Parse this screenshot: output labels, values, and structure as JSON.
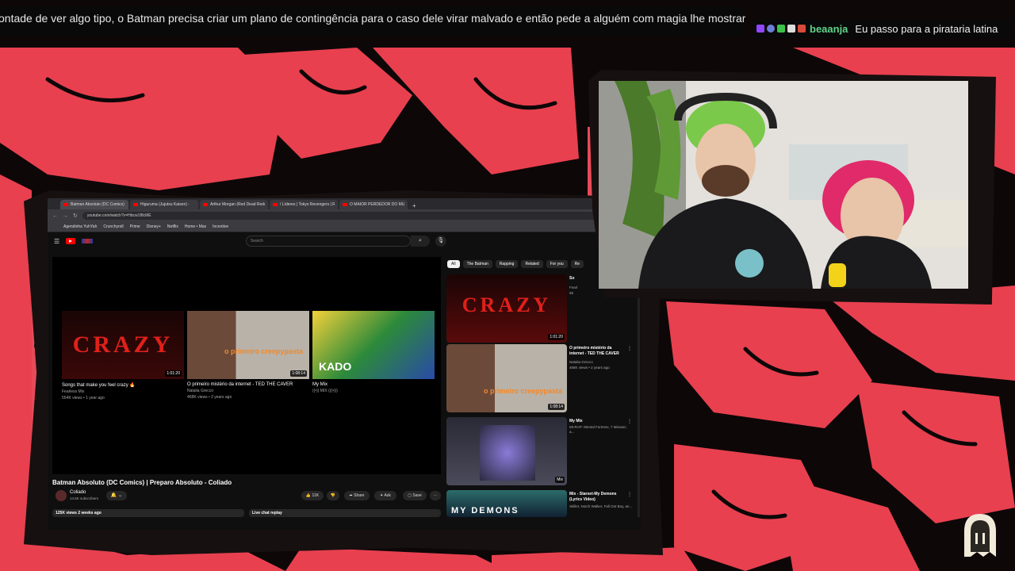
{
  "ticker": {
    "text": "ontade de ver algo tipo, o Batman precisa criar um plano de contingência para o caso dele virar malvado e então pede a alguém com magia lhe mostrar esses"
  },
  "chat": {
    "username": "beaanja",
    "message": "Eu passo para a pirataria latina",
    "badges": [
      "twitch-badge",
      "globe-badge",
      "check-badge",
      "pixel-badge",
      "mask-badge"
    ]
  },
  "colors": {
    "background_red": "#e8404f",
    "background_dark": "#0e0708",
    "accent_green": "#5fd38a"
  },
  "browser": {
    "tabs": [
      {
        "label": "Batman Absoluto (DC Comics) |"
      },
      {
        "label": "Higuruma (Jujutsu Kaisen) -"
      },
      {
        "label": "Arthur Morgan (Red Dead Rede"
      },
      {
        "label": "/ Líderes | Tokyo Revengers | R"
      },
      {
        "label": "O MAIOR PERDEDOR DO MUN"
      }
    ],
    "new_tab": "+",
    "url": "youtube.com/watch?v=Hbcw1f8cME",
    "bookmarks": [
      "Agendinha YuhYah",
      "Crunchyroll",
      "Prime",
      "Disney+",
      "Netflix",
      "Home • Max",
      "Incentive"
    ]
  },
  "youtube": {
    "search_placeholder": "Search",
    "search_icon": "search-icon",
    "endcards": [
      {
        "title": "Songs that make you feel crazy 🔥",
        "channel": "Fearless Mix",
        "meta": "554K views • 1 year ago",
        "duration": "1:01:20",
        "thumb_text": "CRAZY"
      },
      {
        "title": "O primeiro mistério da internet - TED THE CAVER",
        "channel": "Natalia Grecco",
        "meta": "468K views • 2 years ago",
        "duration": "1:08:14",
        "thumb_text": "o primeiro creepypasta"
      },
      {
        "title": "My Mix",
        "channel": "",
        "meta": "((•)) MIX (((•)))",
        "duration": "",
        "thumb_text": "KADO"
      }
    ],
    "video_title": "Batman Absoluto (DC Comics) | Preparo Absoluto - Coliado",
    "channel_name": "Coliado",
    "subscribers": "14.6K subscribers",
    "likes": "11K",
    "share_label": "Share",
    "ask_label": "Ask",
    "save_label": "Save",
    "views_line": "125K views  2 weeks ago",
    "live_chat": "Live chat replay",
    "chips": [
      "All",
      "The Batman",
      "Rapping",
      "Related",
      "For you",
      "Re"
    ],
    "recommendations": [
      {
        "title": "So",
        "meta": "Fearl",
        "meta2": "55",
        "duration": "1:01:20",
        "thumb_text": "CRAZY"
      },
      {
        "title": "O primeiro mistério da internet - TED THE CAVER",
        "meta": "Natalia Grecco",
        "meta2": "468K views • 2 years ago",
        "duration": "1:08:14",
        "thumb_text": "o primeiro creepypasta"
      },
      {
        "title": "My Mix",
        "meta": "MI-RAP: Mental Fortress, 7 Minutoz, a...",
        "meta2": "",
        "duration": "Mix",
        "thumb_text": ""
      },
      {
        "title": "Mix - Starset-My Demons (Lyrics Video)",
        "meta": "Skillet, Notch Walker, Fall Out Boy, an...",
        "meta2": "",
        "duration": "",
        "thumb_text": "MY DEMONS"
      }
    ]
  }
}
